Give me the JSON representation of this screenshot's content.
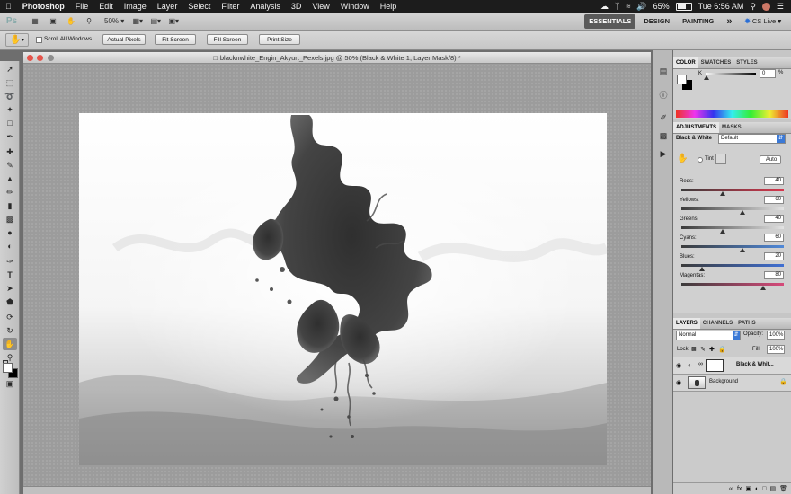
{
  "menubar": {
    "app_name": "Photoshop",
    "items": [
      "File",
      "Edit",
      "Image",
      "Layer",
      "Select",
      "Filter",
      "Analysis",
      "3D",
      "View",
      "Window",
      "Help"
    ],
    "battery": "65%",
    "clock": "Tue 6:56 AM"
  },
  "appbar": {
    "logo": "Ps",
    "zoom": "50%",
    "workspaces": [
      "ESSENTIALS",
      "DESIGN",
      "PAINTING"
    ],
    "more": "»",
    "cs_live": "CS Live"
  },
  "options": {
    "scroll_all": "Scroll All Windows",
    "buttons": [
      "Actual Pixels",
      "Fit Screen",
      "Fill Screen",
      "Print Size"
    ]
  },
  "document": {
    "title": "blacknwhite_Engin_Akyurt_Pexels.jpg @ 50% (Black & White 1, Layer Mask/8) *"
  },
  "color_panel": {
    "tabs": [
      "COLOR",
      "SWATCHES",
      "STYLES"
    ],
    "k_label": "K",
    "k_value": "0",
    "pct": "%",
    "fg_color": "#ffffff",
    "bg_color": "#000000"
  },
  "adjustments": {
    "tabs": [
      "ADJUSTMENTS",
      "MASKS"
    ],
    "preset_label": "Black & White",
    "preset_value": "Default",
    "tint_label": "Tint",
    "auto_label": "Auto",
    "sliders": [
      {
        "label": "Reds:",
        "value": "40",
        "level": 0.4,
        "track": [
          "#3b3b3b",
          "#d7374d"
        ]
      },
      {
        "label": "Yellows:",
        "value": "60",
        "level": 0.6,
        "track": [
          "#3b3b3b",
          "#e2e2e2"
        ]
      },
      {
        "label": "Greens:",
        "value": "40",
        "level": 0.4,
        "track": [
          "#3b3b3b",
          "#e2e2e2"
        ]
      },
      {
        "label": "Cyans:",
        "value": "60",
        "level": 0.6,
        "track": [
          "#3b3b3b",
          "#4f88d8"
        ]
      },
      {
        "label": "Blues:",
        "value": "20",
        "level": 0.2,
        "track": [
          "#3b3b3b",
          "#3f6fd3"
        ]
      },
      {
        "label": "Magentas:",
        "value": "80",
        "level": 0.8,
        "track": [
          "#3b3b3b",
          "#d64a7a"
        ]
      }
    ]
  },
  "layers_panel": {
    "tabs": [
      "LAYERS",
      "CHANNELS",
      "PATHS"
    ],
    "blend_mode": "Normal",
    "opacity_label": "Opacity:",
    "opacity_value": "100%",
    "lock_label": "Lock:",
    "fill_label": "Fill:",
    "fill_value": "100%",
    "layers": [
      {
        "name": "Black & Whit..."
      },
      {
        "name": "Background"
      }
    ]
  },
  "colors": {
    "menubar": "#1c1c1c",
    "ink": "#3a3a3a",
    "selection": "#3b79d6"
  }
}
